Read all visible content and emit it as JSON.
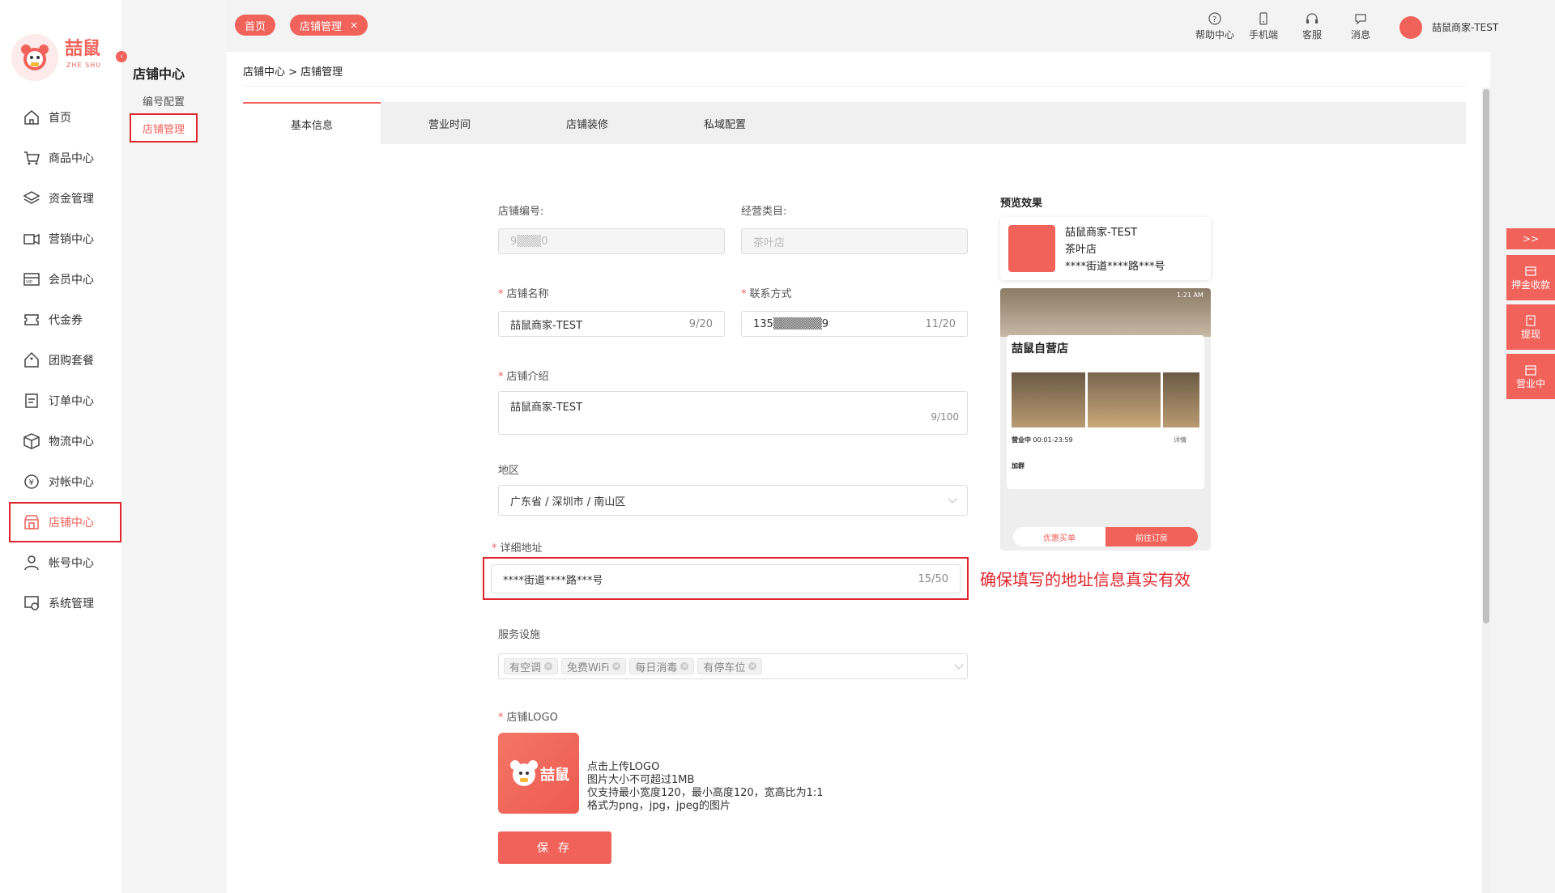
{
  "brand": {
    "name": "喆鼠",
    "sub": "ZHE SHU"
  },
  "nav": [
    {
      "label": "首页",
      "icon": "home-icon"
    },
    {
      "label": "商品中心",
      "icon": "cart-icon"
    },
    {
      "label": "资金管理",
      "icon": "layers-icon"
    },
    {
      "label": "营销中心",
      "icon": "megaphone-icon"
    },
    {
      "label": "会员中心",
      "icon": "vip-card-icon"
    },
    {
      "label": "代金券",
      "icon": "coupon-icon"
    },
    {
      "label": "团购套餐",
      "icon": "tag-icon"
    },
    {
      "label": "订单中心",
      "icon": "order-icon"
    },
    {
      "label": "物流中心",
      "icon": "box-icon"
    },
    {
      "label": "对帐中心",
      "icon": "yen-icon"
    },
    {
      "label": "店铺中心",
      "icon": "store-icon"
    },
    {
      "label": "帐号中心",
      "icon": "user-icon"
    },
    {
      "label": "系统管理",
      "icon": "settings-icon"
    }
  ],
  "subnav": {
    "title": "店铺中心",
    "items": [
      "编号配置",
      "店铺管理"
    ]
  },
  "topbar": {
    "tags": [
      {
        "label": "首页"
      },
      {
        "label": "店铺管理",
        "close": "×"
      }
    ],
    "icons": [
      {
        "label": "帮助中心"
      },
      {
        "label": "手机端"
      },
      {
        "label": "客服"
      },
      {
        "label": "消息"
      }
    ],
    "user": "喆鼠商家-TEST"
  },
  "breadcrumb": "店铺中心 > 店铺管理",
  "tabs": [
    "基本信息",
    "营业时间",
    "店铺装修",
    "私域配置"
  ],
  "form": {
    "store_no_label": "店铺编号:",
    "store_no_value": "9▒▒▒0",
    "category_label": "经营类目:",
    "category_value": "茶叶店",
    "name_label": "店铺名称",
    "name_value": "喆鼠商家-TEST",
    "name_count": "9/20",
    "contact_label": "联系方式",
    "contact_value": "135▒▒▒▒▒▒9",
    "contact_count": "11/20",
    "intro_label": "店铺介绍",
    "intro_value": "喆鼠商家-TEST",
    "intro_count": "9/100",
    "region_label": "地区",
    "region_value": "广东省 / 深圳市 / 南山区",
    "address_label": "详细地址",
    "address_value": "****街道****路***号",
    "address_count": "15/50",
    "facilities_label": "服务设施",
    "facilities": [
      "有空调",
      "免费WiFi",
      "每日消毒",
      "有停车位"
    ],
    "logo_label": "店铺LOGO",
    "logo_hints": [
      "点击上传LOGO",
      "图片大小不可超过1MB",
      "仅支持最小宽度120，最小高度120，宽高比为1:1",
      "格式为png，jpg，jpeg的图片"
    ],
    "save": "保 存"
  },
  "preview": {
    "title": "预览效果",
    "name": "喆鼠商家-TEST",
    "category": "茶叶店",
    "address": "****街道****路***号",
    "phone": {
      "time": "1:21 AM",
      "store": "喆鼠自营店",
      "open": "营业中",
      "hours": "00:01-23:59",
      "detail": "详情",
      "join": "加群",
      "btn1": "优惠买单",
      "btn2": "前往订房"
    }
  },
  "annotation": "确保填写的地址信息真实有效",
  "right_panel": [
    ">>",
    "押金收款",
    "提现",
    "营业中"
  ],
  "colors": {
    "accent": "#f0625a",
    "highlight": "#e0252c"
  }
}
